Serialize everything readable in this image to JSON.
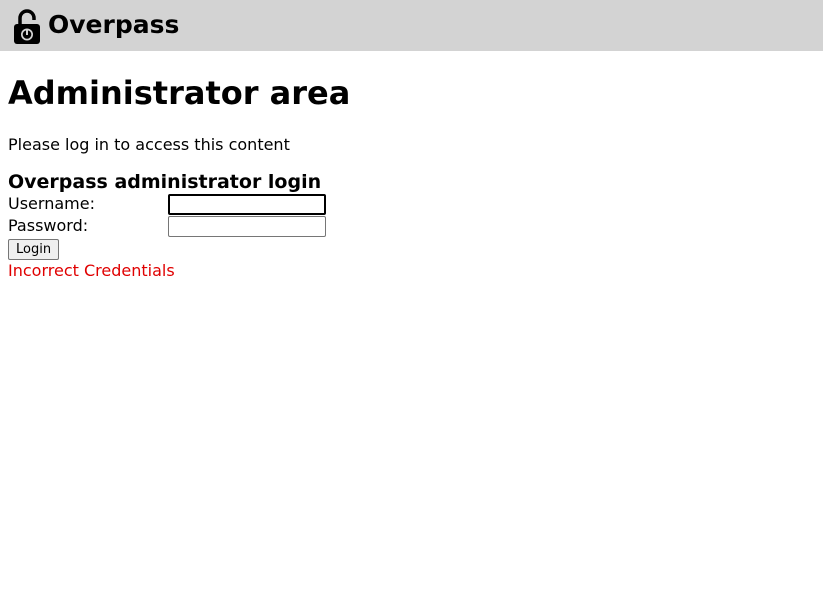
{
  "header": {
    "brand": "Overpass",
    "logo_icon": "padlock-unlocked-icon"
  },
  "main": {
    "title": "Administrator area",
    "intro": "Please log in to access this content"
  },
  "login_form": {
    "title": "Overpass administrator login",
    "username_label": "Username:",
    "username_value": "",
    "password_label": "Password:",
    "password_value": "",
    "submit_label": "Login",
    "error_message": "Incorrect Credentials"
  },
  "colors": {
    "header_bg": "#d3d3d3",
    "error": "#e00000"
  }
}
